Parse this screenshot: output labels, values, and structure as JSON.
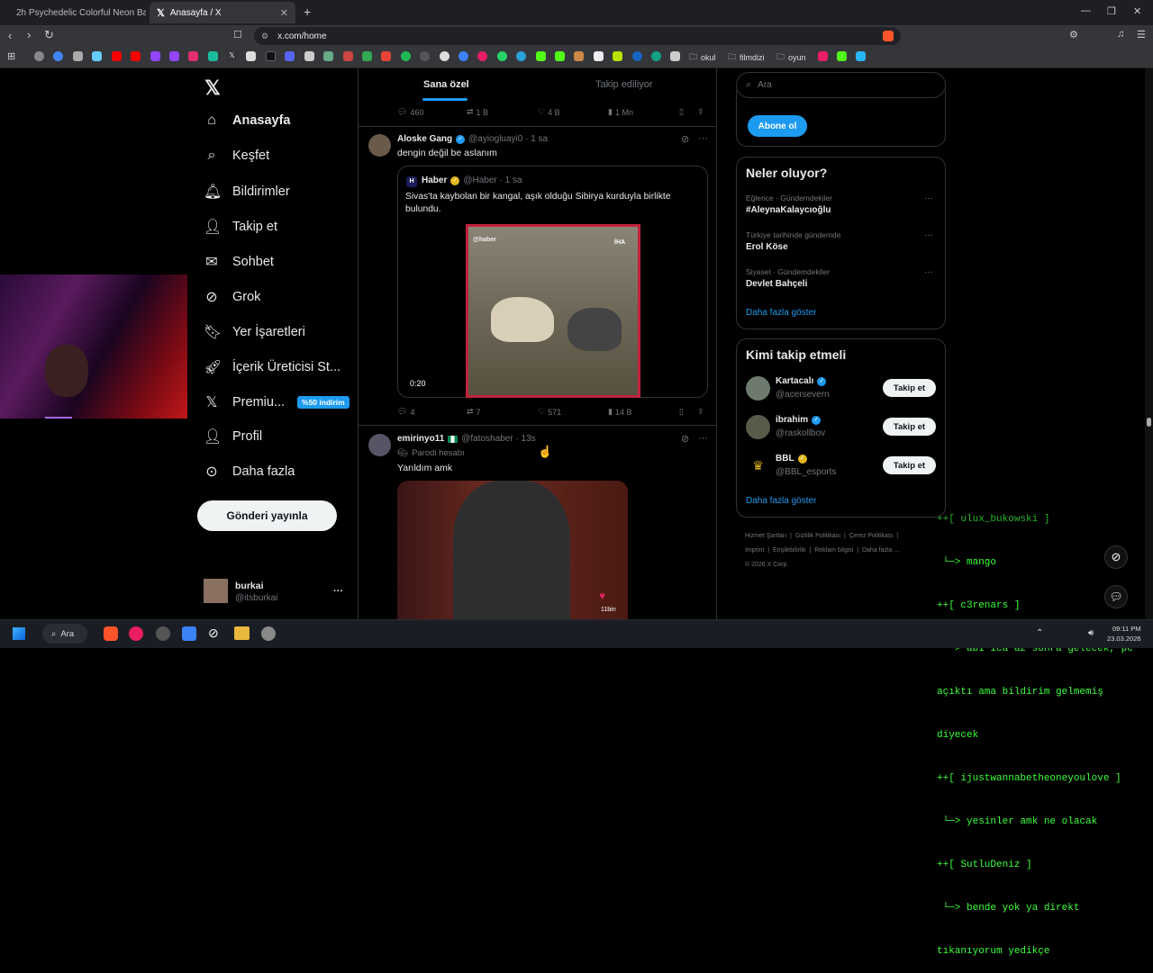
{
  "browser": {
    "tabs": [
      {
        "label": "2h Psychedelic Colorful Neon Backgr"
      },
      {
        "label": "Anasayfa / X"
      }
    ],
    "url": "x.com/home",
    "bookmark_folders": [
      "okul",
      "filmdizi",
      "oyun"
    ],
    "accent_color": "#1d9bf0"
  },
  "nav": {
    "items": [
      {
        "label": "Anasayfa",
        "icon": "home-icon"
      },
      {
        "label": "Keşfet",
        "icon": "search-icon"
      },
      {
        "label": "Bildirimler",
        "icon": "bell-icon"
      },
      {
        "label": "Takip et",
        "icon": "person-add-icon"
      },
      {
        "label": "Sohbet",
        "icon": "mail-icon"
      },
      {
        "label": "Grok",
        "icon": "grok-icon"
      },
      {
        "label": "Yer İşaretleri",
        "icon": "bookmark-icon"
      },
      {
        "label": "İçerik Üreticisi St...",
        "icon": "rocket-icon"
      },
      {
        "label": "Premiu...",
        "icon": "x-logo-icon",
        "badge": "%50 indirim"
      },
      {
        "label": "Profil",
        "icon": "person-icon"
      },
      {
        "label": "Daha fazla",
        "icon": "more-circle-icon"
      }
    ],
    "post_button": "Gönderi yayınla",
    "account": {
      "name": "burkai",
      "handle": "@itsburkai",
      "more": "···"
    }
  },
  "timeline": {
    "tabs": [
      "Sana özel",
      "Takip ediliyor"
    ],
    "prev_actions": {
      "replies": "460",
      "reposts": "1 B",
      "likes": "4 B",
      "views": "1 Mn"
    },
    "post1": {
      "name": "Aloske Gang",
      "handle": "@ayiogluayi0 · 1 sa",
      "text": "dengin değil be aslanım",
      "quote": {
        "name": "Haber",
        "handle": "@Haber · 1 sa",
        "text": "Sivas'ta kaybolan bir kangal, aşık olduğu Sibirya kurduyla birlikte bulundu.",
        "video_time": "0:20",
        "watermark_left": "@haber",
        "watermark_right": "İHA"
      },
      "actions": {
        "replies": "4",
        "reposts": "7",
        "likes": "571",
        "views": "14 B"
      }
    },
    "post2": {
      "name": "emirinyo11",
      "handle": "@fatoshaber · 13s",
      "label": "Parodi hesabı",
      "text": "Yarıldım amk",
      "overlay": "11bin"
    }
  },
  "sidebar": {
    "search_placeholder": "Ara",
    "subscribe": "Abone ol",
    "trends_title": "Neler oluyor?",
    "trends": [
      {
        "context": "Eğlence · Gündemdekiler",
        "title": "#AleynaKalaycıoğlu"
      },
      {
        "context": "Türkiye tarihinde gündemde",
        "title": "Erol Köse"
      },
      {
        "context": "Siyaset · Gündemdekiler",
        "title": "Devlet Bahçeli"
      }
    ],
    "show_more": "Daha fazla göster",
    "who_title": "Kimi takip etmeli",
    "who": [
      {
        "name": "Kartacalı",
        "handle": "@acersevern",
        "button": "Takip et"
      },
      {
        "name": "ibrahim",
        "handle": "@raskollbov",
        "button": "Takip et"
      },
      {
        "name": "BBL",
        "handle": "@BBL_esports",
        "button": "Takip et"
      }
    ],
    "footer": [
      "Hizmet Şartları",
      "Gizlilik Politikası",
      "Çerez Politikası",
      "Imprint",
      "Erişilebilirlik",
      "Reklam bilgisi",
      "Daha fazla ...",
      "© 2026 X Corp."
    ]
  },
  "chat_overlay": {
    "lines": [
      "++[ ulux_bukowski ]",
      " └─> mango",
      "++[ c3renars ]",
      " └─> abi ica az sonra gelecek, pc",
      "açıktı ama bildirim gelmemiş",
      "diyecek",
      "++[ ijustwannabetheoneyoulove ]",
      " └─> yesinler amk ne olacak",
      "++[ SutluDeniz ]",
      " └─> bende yok ya direkt",
      "tıkanıyorum yedikçe"
    ]
  },
  "taskbar": {
    "search": "Ara",
    "time": "09:11 PM",
    "date": "23.03.2026"
  }
}
